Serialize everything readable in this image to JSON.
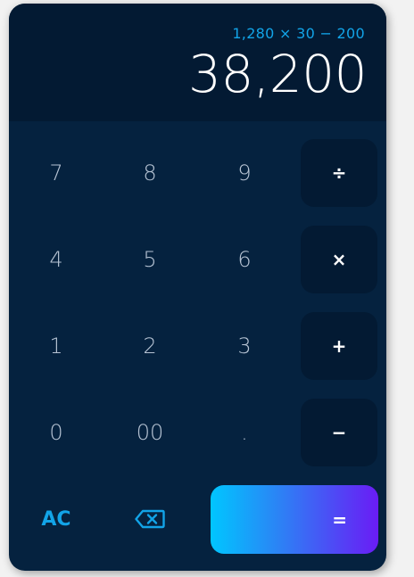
{
  "display": {
    "expression": "1,280 × 30 − 200",
    "result": "38,200"
  },
  "keys": {
    "seven": "7",
    "eight": "8",
    "nine": "9",
    "divide": "÷",
    "four": "4",
    "five": "5",
    "six": "6",
    "multiply": "×",
    "one": "1",
    "two": "2",
    "three": "3",
    "plus": "+",
    "zero": "0",
    "double_zero": "00",
    "dot": ".",
    "minus": "−",
    "clear": "AC",
    "backspace_icon": "backspace-icon",
    "equals": "="
  },
  "colors": {
    "accent": "#12a4e8",
    "body": "#05223f",
    "display": "#031a33",
    "equals_gradient_start": "#00c6ff",
    "equals_gradient_end": "#6a1cf5"
  }
}
